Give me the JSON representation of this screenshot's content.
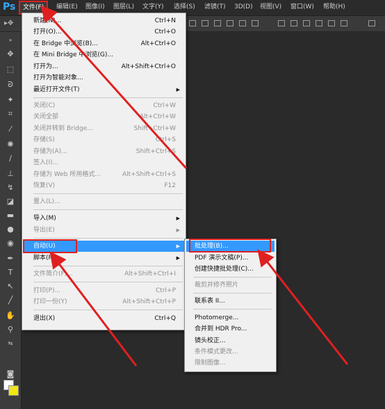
{
  "app": {
    "logo": "Ps"
  },
  "menubar": {
    "items": [
      "文件(F)",
      "编辑(E)",
      "图像(I)",
      "图层(L)",
      "文字(Y)",
      "选择(S)",
      "滤镜(T)",
      "3D(D)",
      "视图(V)",
      "窗口(W)",
      "帮助(H)"
    ]
  },
  "file_menu": {
    "items": [
      {
        "label": "新建(N)...",
        "shortcut": "Ctrl+N"
      },
      {
        "label": "打开(O)...",
        "shortcut": "Ctrl+O"
      },
      {
        "label": "在 Bridge 中浏览(B)...",
        "shortcut": "Alt+Ctrl+O"
      },
      {
        "label": "在 Mini Bridge 中浏览(G)...",
        "shortcut": ""
      },
      {
        "label": "打开为...",
        "shortcut": "Alt+Shift+Ctrl+O"
      },
      {
        "label": "打开为智能对象...",
        "shortcut": ""
      },
      {
        "label": "最近打开文件(T)",
        "shortcut": ""
      },
      {
        "label": "关闭(C)",
        "shortcut": "Ctrl+W"
      },
      {
        "label": "关闭全部",
        "shortcut": "Alt+Ctrl+W"
      },
      {
        "label": "关闭并转到 Bridge...",
        "shortcut": "Shift+Ctrl+W"
      },
      {
        "label": "存储(S)",
        "shortcut": "Ctrl+S"
      },
      {
        "label": "存储为(A)...",
        "shortcut": "Shift+Ctrl+S"
      },
      {
        "label": "签入(I)...",
        "shortcut": ""
      },
      {
        "label": "存储为 Web 所用格式...",
        "shortcut": "Alt+Shift+Ctrl+S"
      },
      {
        "label": "恢复(V)",
        "shortcut": "F12"
      },
      {
        "label": "置入(L)...",
        "shortcut": ""
      },
      {
        "label": "导入(M)",
        "shortcut": ""
      },
      {
        "label": "导出(E)",
        "shortcut": ""
      },
      {
        "label": "自动(U)",
        "shortcut": ""
      },
      {
        "label": "脚本(R)",
        "shortcut": ""
      },
      {
        "label": "文件简介(F)...",
        "shortcut": "Alt+Shift+Ctrl+I"
      },
      {
        "label": "打印(P)...",
        "shortcut": "Ctrl+P"
      },
      {
        "label": "打印一份(Y)",
        "shortcut": "Alt+Shift+Ctrl+P"
      },
      {
        "label": "退出(X)",
        "shortcut": "Ctrl+Q"
      }
    ]
  },
  "auto_submenu": {
    "items": [
      "批处理(B)...",
      "PDF 演示文稿(P)...",
      "创建快捷批处理(C)...",
      "裁剪并修齐照片",
      "联系表 II...",
      "Photomerge...",
      "合并到 HDR Pro...",
      "镜头校正...",
      "条件模式更改...",
      "限制图像..."
    ]
  },
  "colors": {
    "accent": "#3399ff",
    "annotation": "#e02020",
    "background_swatch": "#f3e60f"
  }
}
